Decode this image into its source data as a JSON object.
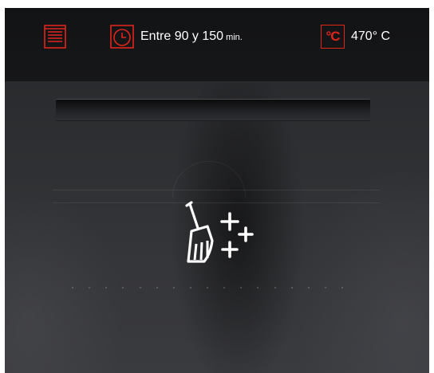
{
  "status_bar": {
    "mode": {
      "icon": "oven-mode-icon"
    },
    "duration": {
      "icon": "clock-icon",
      "text": "Entre 90 y 150",
      "unit": "min."
    },
    "temperature": {
      "icon": "celsius-icon",
      "glyph": "°C",
      "value": "470° C"
    }
  },
  "center": {
    "icon": "cleaning-broom-sparkle-icon"
  },
  "colors": {
    "accent": "#e1251b",
    "text": "#ffffff",
    "panel": "#121315",
    "door": "#2f3034"
  }
}
